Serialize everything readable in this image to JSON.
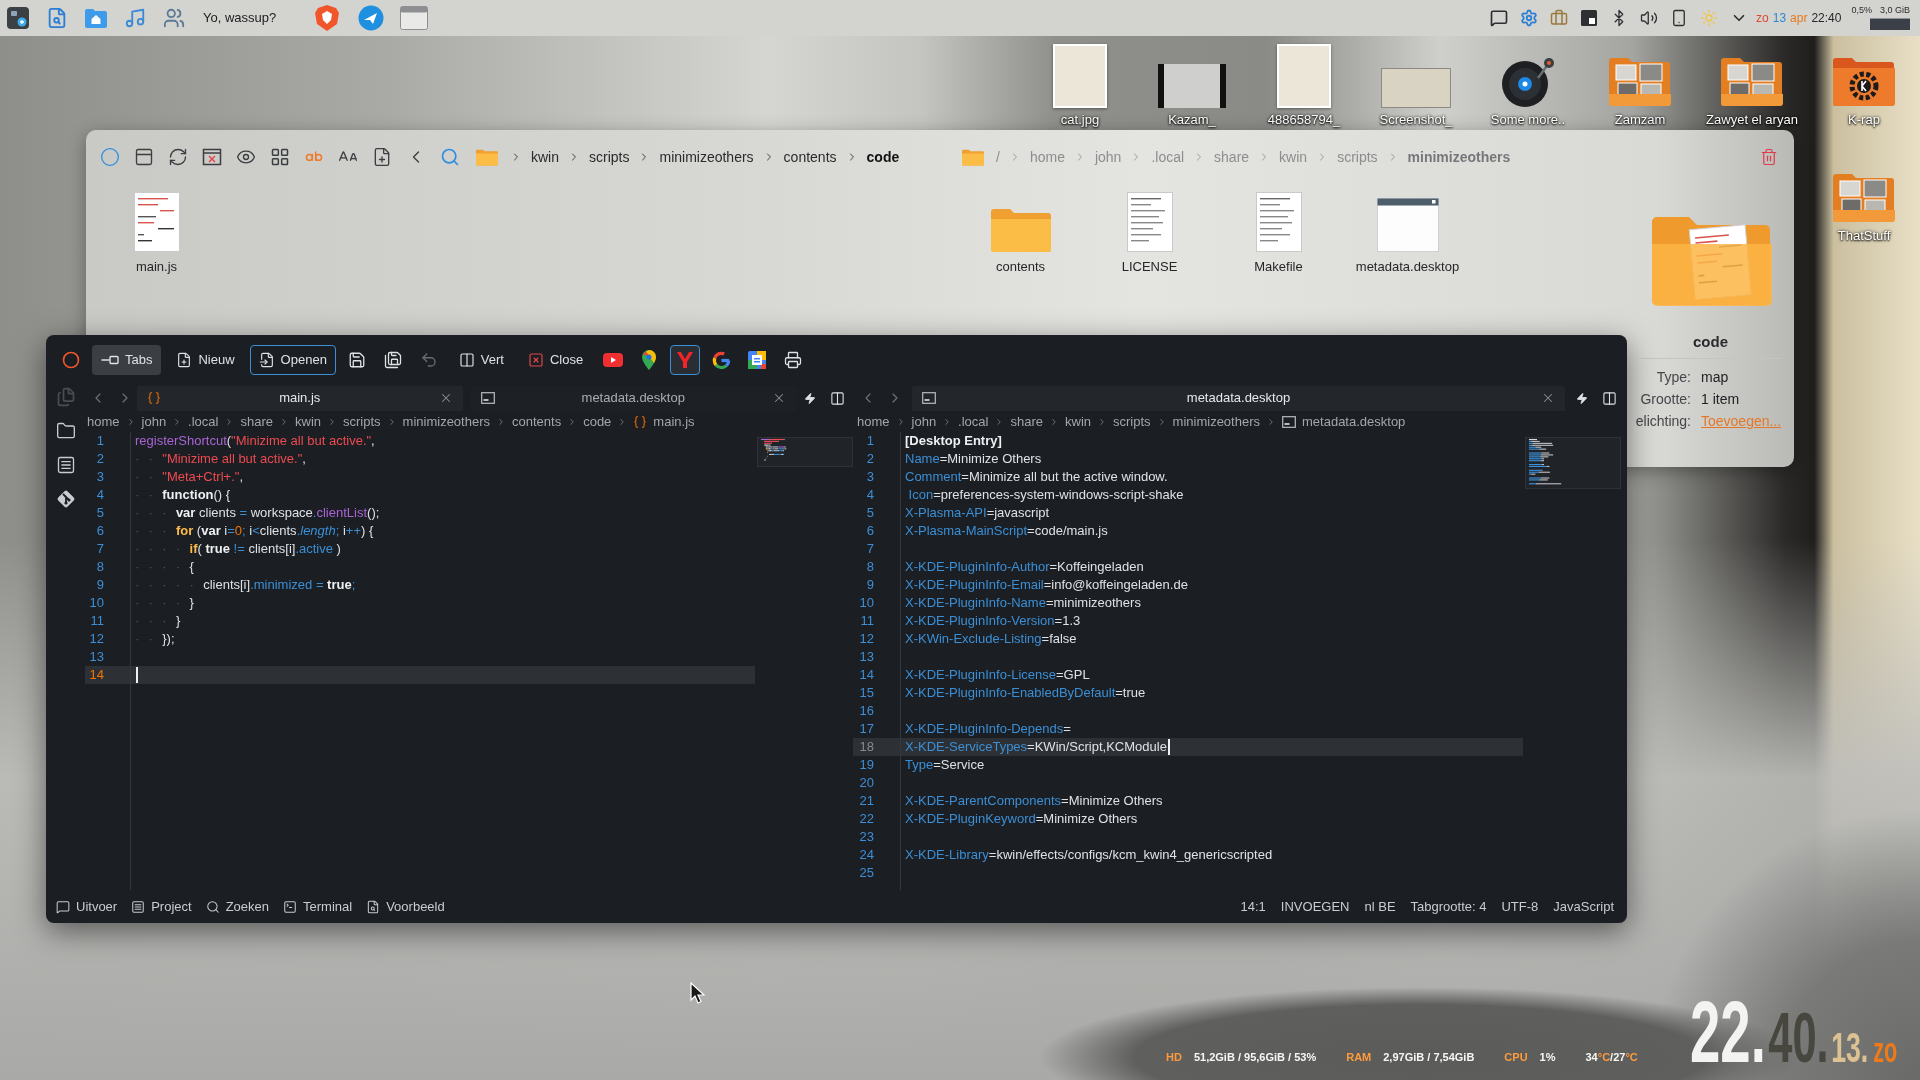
{
  "top_panel": {
    "task_label": "Yo, wassup?",
    "clock": [
      {
        "text": "zo",
        "kind": "weekday"
      },
      {
        "text": "13",
        "kind": "day"
      },
      {
        "text": "apr",
        "kind": "month"
      },
      {
        "text": "22:40",
        "kind": "time"
      }
    ],
    "monitor": [
      "0,5%",
      "3,0 GiB"
    ]
  },
  "desktop_icons": [
    {
      "label": "cat.jpg",
      "kind": "image"
    },
    {
      "label": "Kazam_",
      "kind": "video"
    },
    {
      "label": "488658794_",
      "kind": "image"
    },
    {
      "label": "Screenshot_",
      "kind": "screenshot"
    },
    {
      "label": "Some more..",
      "kind": "audio"
    },
    {
      "label": "Zamzam",
      "kind": "folder"
    },
    {
      "label": "Zawyet el aryan",
      "kind": "folder"
    },
    {
      "label": "K-rap",
      "kind": "app-folder"
    },
    {
      "label": "ThatStuff",
      "kind": "folder"
    }
  ],
  "file_manager": {
    "left_pane": {
      "focused": true,
      "breadcrumb": [
        "kwin",
        "scripts",
        "minimizeothers",
        "contents",
        "code"
      ],
      "files": [
        {
          "name": "main.js",
          "kind": "script"
        }
      ]
    },
    "right_pane": {
      "focused": false,
      "breadcrumb": [
        "/",
        "home",
        "john",
        ".local",
        "share",
        "kwin",
        "scripts",
        "minimizeothers"
      ],
      "files": [
        {
          "name": "contents",
          "kind": "folder"
        },
        {
          "name": "LICENSE",
          "kind": "text"
        },
        {
          "name": "Makefile",
          "kind": "text"
        },
        {
          "name": "metadata.desktop",
          "kind": "desktop"
        }
      ]
    },
    "info_panel": {
      "title": "code",
      "fields": [
        {
          "label": "Type:",
          "value": "map",
          "kind": "text"
        },
        {
          "label": "Grootte:",
          "value": "1 item",
          "kind": "text"
        },
        {
          "label": "elichting:",
          "value": "Toevoegen...",
          "kind": "link"
        }
      ]
    }
  },
  "editor": {
    "toolbar": [
      {
        "kind": "icon",
        "focused": false,
        "disabled": false
      },
      {
        "kind": "text",
        "label": "Tabs",
        "checked": true,
        "focused": false,
        "disabled": false
      },
      {
        "kind": "text",
        "label": "Nieuw",
        "checked": false,
        "focused": false,
        "disabled": false
      },
      {
        "kind": "text",
        "label": "Openen",
        "checked": false,
        "focused": true,
        "disabled": false
      },
      {
        "kind": "icon",
        "focused": false,
        "disabled": false
      },
      {
        "kind": "icon",
        "focused": false,
        "disabled": false
      },
      {
        "kind": "icon",
        "focused": false,
        "disabled": true
      },
      {
        "kind": "text",
        "label": "Vert",
        "checked": false,
        "focused": false,
        "disabled": false
      },
      {
        "kind": "text",
        "label": "Close",
        "checked": false,
        "focused": false,
        "disabled": false
      },
      {
        "kind": "icon",
        "focused": false,
        "disabled": false
      },
      {
        "kind": "icon",
        "focused": false,
        "disabled": false
      },
      {
        "kind": "icon",
        "focused": true,
        "disabled": false
      },
      {
        "kind": "icon",
        "focused": false,
        "disabled": false
      },
      {
        "kind": "icon",
        "focused": false,
        "disabled": false
      },
      {
        "kind": "icon",
        "focused": false,
        "disabled": false
      }
    ],
    "panes": [
      {
        "focused": true,
        "tabs": [
          {
            "label": "main.js",
            "kind": "script",
            "selected": true
          },
          {
            "label": "metadata.desktop",
            "kind": "desktop",
            "selected": false
          }
        ],
        "breadcrumb": [
          "home",
          "john",
          ".local",
          "share",
          "kwin",
          "scripts",
          "minimizeothers",
          "contents",
          "code",
          "main.js"
        ],
        "lines": [
          {
            "no": "1",
            "current": false,
            "tokens": [
              {
                "text": "registerShortcut",
                "kind": "fn"
              },
              {
                "text": "(",
                "kind": "plain"
              },
              {
                "text": "\"Minizime all but active.\"",
                "kind": "str"
              },
              {
                "text": ",",
                "kind": "plain"
              }
            ]
          },
          {
            "no": "2",
            "current": false,
            "tokens": [
              {
                "text": "··",
                "kind": "ws"
              },
              {
                "text": "\"Minizime all but active.\"",
                "kind": "str"
              },
              {
                "text": ",",
                "kind": "plain"
              }
            ]
          },
          {
            "no": "3",
            "current": false,
            "tokens": [
              {
                "text": "··",
                "kind": "ws"
              },
              {
                "text": "\"Meta+Ctrl+.\"",
                "kind": "str"
              },
              {
                "text": ",",
                "kind": "plain"
              }
            ]
          },
          {
            "no": "4",
            "current": false,
            "tokens": [
              {
                "text": "··",
                "kind": "ws"
              },
              {
                "text": "function",
                "kind": "kw"
              },
              {
                "text": "() {",
                "kind": "plain"
              }
            ]
          },
          {
            "no": "5",
            "current": false,
            "tokens": [
              {
                "text": "···",
                "kind": "ws"
              },
              {
                "text": "var",
                "kind": "kw"
              },
              {
                "text": " clients ",
                "kind": "plain"
              },
              {
                "text": "=",
                "kind": "op"
              },
              {
                "text": " workspace",
                "kind": "plain"
              },
              {
                "text": ".",
                "kind": "op"
              },
              {
                "text": "clientList",
                "kind": "fn"
              },
              {
                "text": "();",
                "kind": "plain"
              }
            ]
          },
          {
            "no": "6",
            "current": false,
            "tokens": [
              {
                "text": "···",
                "kind": "ws"
              },
              {
                "text": "for",
                "kind": "kw2"
              },
              {
                "text": " (",
                "kind": "plain"
              },
              {
                "text": "var",
                "kind": "kw"
              },
              {
                "text": " i",
                "kind": "plain"
              },
              {
                "text": "=",
                "kind": "op"
              },
              {
                "text": "0",
                "kind": "num"
              },
              {
                "text": ";",
                "kind": "op"
              },
              {
                "text": " i",
                "kind": "plain"
              },
              {
                "text": "<",
                "kind": "op"
              },
              {
                "text": "clients",
                "kind": "plain"
              },
              {
                "text": ".",
                "kind": "op"
              },
              {
                "text": "length",
                "kind": "propi"
              },
              {
                "text": ";",
                "kind": "op"
              },
              {
                "text": " i",
                "kind": "plain"
              },
              {
                "text": "++",
                "kind": "op"
              },
              {
                "text": ") {",
                "kind": "plain"
              }
            ]
          },
          {
            "no": "7",
            "current": false,
            "tokens": [
              {
                "text": "····",
                "kind": "ws"
              },
              {
                "text": "if",
                "kind": "kw2"
              },
              {
                "text": "( ",
                "kind": "plain"
              },
              {
                "text": "true",
                "kind": "kw"
              },
              {
                "text": " != ",
                "kind": "op"
              },
              {
                "text": "clients[i]",
                "kind": "plain"
              },
              {
                "text": ".",
                "kind": "op"
              },
              {
                "text": "active",
                "kind": "prop"
              },
              {
                "text": " )",
                "kind": "plain"
              }
            ]
          },
          {
            "no": "8",
            "current": false,
            "tokens": [
              {
                "text": "····",
                "kind": "ws"
              },
              {
                "text": "{",
                "kind": "plain"
              }
            ]
          },
          {
            "no": "9",
            "current": false,
            "tokens": [
              {
                "text": "·····",
                "kind": "ws"
              },
              {
                "text": "clients[i]",
                "kind": "plain"
              },
              {
                "text": ".",
                "kind": "op"
              },
              {
                "text": "minimized",
                "kind": "prop"
              },
              {
                "text": " = ",
                "kind": "op"
              },
              {
                "text": "true",
                "kind": "kw"
              },
              {
                "text": ";",
                "kind": "op"
              }
            ]
          },
          {
            "no": "10",
            "current": false,
            "tokens": [
              {
                "text": "····",
                "kind": "ws"
              },
              {
                "text": "}",
                "kind": "plain"
              }
            ]
          },
          {
            "no": "11",
            "current": false,
            "tokens": [
              {
                "text": "···",
                "kind": "ws"
              },
              {
                "text": "}",
                "kind": "plain"
              }
            ]
          },
          {
            "no": "12",
            "current": false,
            "tokens": [
              {
                "text": "··",
                "kind": "ws"
              },
              {
                "text": "});",
                "kind": "plain"
              }
            ]
          },
          {
            "no": "13",
            "current": false
          },
          {
            "no": "14",
            "current": true
          }
        ]
      },
      {
        "focused": false,
        "tabs": [
          {
            "label": "metadata.desktop",
            "kind": "desktop",
            "selected": true
          }
        ],
        "breadcrumb": [
          "home",
          "john",
          ".local",
          "share",
          "kwin",
          "scripts",
          "minimizeothers",
          "metadata.desktop"
        ],
        "lines": [
          {
            "no": "1",
            "current": false,
            "tokens": [
              {
                "text": "[Desktop Entry]",
                "kind": "section"
              }
            ]
          },
          {
            "no": "2",
            "current": false,
            "tokens": [
              {
                "text": "Name",
                "kind": "key"
              },
              {
                "text": "=Minimize Others",
                "kind": "plain"
              }
            ]
          },
          {
            "no": "3",
            "current": false,
            "tokens": [
              {
                "text": "Comment",
                "kind": "key"
              },
              {
                "text": "=Minimize all but the active window.",
                "kind": "plain"
              }
            ]
          },
          {
            "no": "4",
            "current": false,
            "tokens": [
              {
                "text": " Icon",
                "kind": "key"
              },
              {
                "text": "=preferences-system-windows-script-shake",
                "kind": "plain"
              }
            ]
          },
          {
            "no": "5",
            "current": false,
            "tokens": [
              {
                "text": "X-Plasma-API",
                "kind": "key"
              },
              {
                "text": "=javascript",
                "kind": "plain"
              }
            ]
          },
          {
            "no": "6",
            "current": false,
            "tokens": [
              {
                "text": "X-Plasma-MainScript",
                "kind": "key"
              },
              {
                "text": "=code/main.js",
                "kind": "plain"
              }
            ]
          },
          {
            "no": "7",
            "current": false
          },
          {
            "no": "8",
            "current": false,
            "tokens": [
              {
                "text": "X-KDE-PluginInfo-Author",
                "kind": "key"
              },
              {
                "text": "=Koffeingeladen",
                "kind": "plain"
              }
            ]
          },
          {
            "no": "9",
            "current": false,
            "tokens": [
              {
                "text": "X-KDE-PluginInfo-Email",
                "kind": "key"
              },
              {
                "text": "=info@koffeingeladen.de",
                "kind": "plain"
              }
            ]
          },
          {
            "no": "10",
            "current": false,
            "tokens": [
              {
                "text": "X-KDE-PluginInfo-Name",
                "kind": "key"
              },
              {
                "text": "=minimizeothers",
                "kind": "plain"
              }
            ]
          },
          {
            "no": "11",
            "current": false,
            "tokens": [
              {
                "text": "X-KDE-PluginInfo-Version",
                "kind": "key"
              },
              {
                "text": "=1.3",
                "kind": "plain"
              }
            ]
          },
          {
            "no": "12",
            "current": false,
            "tokens": [
              {
                "text": "X-KWin-Exclude-Listing",
                "kind": "key"
              },
              {
                "text": "=false",
                "kind": "plain"
              }
            ]
          },
          {
            "no": "13",
            "current": false
          },
          {
            "no": "14",
            "current": false,
            "tokens": [
              {
                "text": "X-KDE-PluginInfo-License",
                "kind": "key"
              },
              {
                "text": "=GPL",
                "kind": "plain"
              }
            ]
          },
          {
            "no": "15",
            "current": false,
            "tokens": [
              {
                "text": "X-KDE-PluginInfo-EnabledByDefault",
                "kind": "key"
              },
              {
                "text": "=true",
                "kind": "plain"
              }
            ]
          },
          {
            "no": "16",
            "current": false
          },
          {
            "no": "17",
            "current": false,
            "tokens": [
              {
                "text": "X-KDE-PluginInfo-Depends",
                "kind": "key"
              },
              {
                "text": "=",
                "kind": "plain"
              }
            ]
          },
          {
            "no": "18",
            "current": true,
            "tokens": [
              {
                "text": "X-KDE-ServiceTypes",
                "kind": "key"
              },
              {
                "text": "=KWin/Script,KCModule",
                "kind": "plain"
              }
            ]
          },
          {
            "no": "19",
            "current": false,
            "tokens": [
              {
                "text": "Type",
                "kind": "key"
              },
              {
                "text": "=Service",
                "kind": "plain"
              }
            ]
          },
          {
            "no": "20",
            "current": false
          },
          {
            "no": "21",
            "current": false,
            "tokens": [
              {
                "text": "X-KDE-ParentComponents",
                "kind": "key"
              },
              {
                "text": "=Minimize Others",
                "kind": "plain"
              }
            ]
          },
          {
            "no": "22",
            "current": false,
            "tokens": [
              {
                "text": "X-KDE-PluginKeyword",
                "kind": "key"
              },
              {
                "text": "=Minimize Others",
                "kind": "plain"
              }
            ]
          },
          {
            "no": "23",
            "current": false
          },
          {
            "no": "24",
            "current": false,
            "tokens": [
              {
                "text": "X-KDE-Library",
                "kind": "key"
              },
              {
                "text": "=kwin/effects/configs/kcm_kwin4_genericscripted",
                "kind": "plain"
              }
            ]
          },
          {
            "no": "25",
            "current": false
          }
        ]
      }
    ],
    "tool_views": [
      "Uitvoer",
      "Project",
      "Zoeken",
      "Terminal",
      "Voorbeeld"
    ],
    "status": [
      "14:1",
      "INVOEGEN",
      "nl BE",
      "Tabgrootte: 4",
      "UTF-8",
      "JavaScript"
    ]
  },
  "conky": {
    "stats": [
      {
        "label": "HD",
        "value": "51,2GiB / 95,6GiB / 53%"
      },
      {
        "label": "RAM",
        "value": "2,97GiB / 7,54GiB"
      },
      {
        "label": "CPU",
        "value": "1%"
      }
    ],
    "temperature": [
      {
        "text": "34",
        "kind": "value"
      },
      {
        "text": "°C",
        "kind": "unit"
      },
      {
        "text": "/27",
        "kind": "value"
      },
      {
        "text": "°C",
        "kind": "unit"
      }
    ],
    "clock": [
      {
        "text": "22.",
        "kind": "hours"
      },
      {
        "text": "40.",
        "kind": "minutes"
      },
      {
        "text": "13.",
        "kind": "seconds"
      },
      {
        "text": "zo",
        "kind": "weekday"
      }
    ]
  }
}
